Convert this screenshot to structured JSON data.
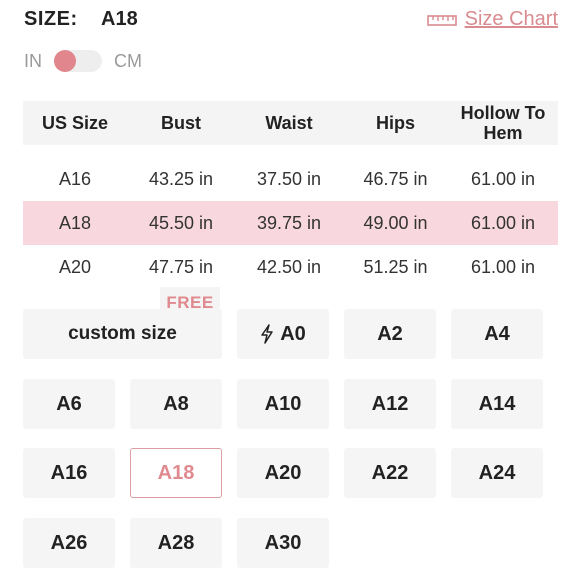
{
  "header": {
    "size_label": "SIZE:",
    "selected_size": "A18",
    "size_chart_label": "Size Chart",
    "size_chart_icon": "ruler-icon"
  },
  "unit_toggle": {
    "left_label": "IN",
    "right_label": "CM",
    "selected": "IN",
    "accent_color": "#e0868c"
  },
  "table": {
    "columns": [
      "US Size",
      "Bust",
      "Waist",
      "Hips",
      "Hollow To Hem"
    ],
    "rows": [
      [
        "A16",
        "43.25  in",
        "37.50 in",
        "46.75  in",
        "61.00  in"
      ],
      [
        "A18",
        "45.50  in",
        "39.75  in",
        "49.00  in",
        "61.00  in"
      ],
      [
        "A20",
        "47.75  in",
        "42.50  in",
        "51.25  in",
        "61.00  in"
      ]
    ],
    "highlighted_row": "A18",
    "highlight_color": "#f8d8de"
  },
  "free_tag": "FREE",
  "sizes": {
    "custom_label": "custom size",
    "a0_icon": "lightning-bolt-icon",
    "options": [
      "A0",
      "A2",
      "A4",
      "A6",
      "A8",
      "A10",
      "A12",
      "A14",
      "A16",
      "A18",
      "A20",
      "A22",
      "A24",
      "A26",
      "A28",
      "A30"
    ],
    "selected": "A18"
  }
}
